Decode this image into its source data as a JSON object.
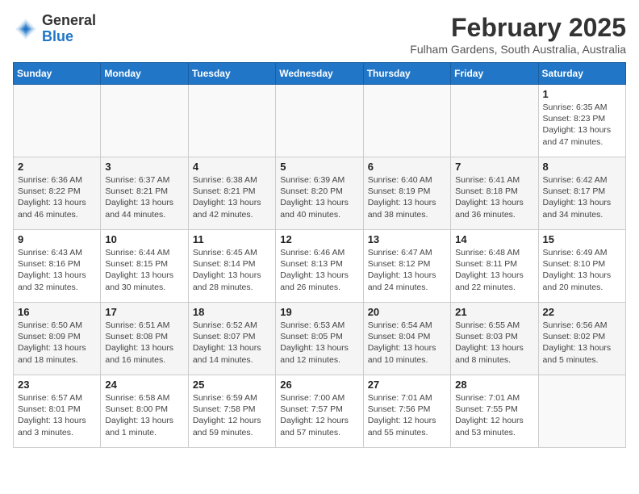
{
  "header": {
    "logo_general": "General",
    "logo_blue": "Blue",
    "month": "February 2025",
    "location": "Fulham Gardens, South Australia, Australia"
  },
  "weekdays": [
    "Sunday",
    "Monday",
    "Tuesday",
    "Wednesday",
    "Thursday",
    "Friday",
    "Saturday"
  ],
  "weeks": [
    [
      {
        "day": "",
        "info": ""
      },
      {
        "day": "",
        "info": ""
      },
      {
        "day": "",
        "info": ""
      },
      {
        "day": "",
        "info": ""
      },
      {
        "day": "",
        "info": ""
      },
      {
        "day": "",
        "info": ""
      },
      {
        "day": "1",
        "info": "Sunrise: 6:35 AM\nSunset: 8:23 PM\nDaylight: 13 hours and 47 minutes."
      }
    ],
    [
      {
        "day": "2",
        "info": "Sunrise: 6:36 AM\nSunset: 8:22 PM\nDaylight: 13 hours and 46 minutes."
      },
      {
        "day": "3",
        "info": "Sunrise: 6:37 AM\nSunset: 8:21 PM\nDaylight: 13 hours and 44 minutes."
      },
      {
        "day": "4",
        "info": "Sunrise: 6:38 AM\nSunset: 8:21 PM\nDaylight: 13 hours and 42 minutes."
      },
      {
        "day": "5",
        "info": "Sunrise: 6:39 AM\nSunset: 8:20 PM\nDaylight: 13 hours and 40 minutes."
      },
      {
        "day": "6",
        "info": "Sunrise: 6:40 AM\nSunset: 8:19 PM\nDaylight: 13 hours and 38 minutes."
      },
      {
        "day": "7",
        "info": "Sunrise: 6:41 AM\nSunset: 8:18 PM\nDaylight: 13 hours and 36 minutes."
      },
      {
        "day": "8",
        "info": "Sunrise: 6:42 AM\nSunset: 8:17 PM\nDaylight: 13 hours and 34 minutes."
      }
    ],
    [
      {
        "day": "9",
        "info": "Sunrise: 6:43 AM\nSunset: 8:16 PM\nDaylight: 13 hours and 32 minutes."
      },
      {
        "day": "10",
        "info": "Sunrise: 6:44 AM\nSunset: 8:15 PM\nDaylight: 13 hours and 30 minutes."
      },
      {
        "day": "11",
        "info": "Sunrise: 6:45 AM\nSunset: 8:14 PM\nDaylight: 13 hours and 28 minutes."
      },
      {
        "day": "12",
        "info": "Sunrise: 6:46 AM\nSunset: 8:13 PM\nDaylight: 13 hours and 26 minutes."
      },
      {
        "day": "13",
        "info": "Sunrise: 6:47 AM\nSunset: 8:12 PM\nDaylight: 13 hours and 24 minutes."
      },
      {
        "day": "14",
        "info": "Sunrise: 6:48 AM\nSunset: 8:11 PM\nDaylight: 13 hours and 22 minutes."
      },
      {
        "day": "15",
        "info": "Sunrise: 6:49 AM\nSunset: 8:10 PM\nDaylight: 13 hours and 20 minutes."
      }
    ],
    [
      {
        "day": "16",
        "info": "Sunrise: 6:50 AM\nSunset: 8:09 PM\nDaylight: 13 hours and 18 minutes."
      },
      {
        "day": "17",
        "info": "Sunrise: 6:51 AM\nSunset: 8:08 PM\nDaylight: 13 hours and 16 minutes."
      },
      {
        "day": "18",
        "info": "Sunrise: 6:52 AM\nSunset: 8:07 PM\nDaylight: 13 hours and 14 minutes."
      },
      {
        "day": "19",
        "info": "Sunrise: 6:53 AM\nSunset: 8:05 PM\nDaylight: 13 hours and 12 minutes."
      },
      {
        "day": "20",
        "info": "Sunrise: 6:54 AM\nSunset: 8:04 PM\nDaylight: 13 hours and 10 minutes."
      },
      {
        "day": "21",
        "info": "Sunrise: 6:55 AM\nSunset: 8:03 PM\nDaylight: 13 hours and 8 minutes."
      },
      {
        "day": "22",
        "info": "Sunrise: 6:56 AM\nSunset: 8:02 PM\nDaylight: 13 hours and 5 minutes."
      }
    ],
    [
      {
        "day": "23",
        "info": "Sunrise: 6:57 AM\nSunset: 8:01 PM\nDaylight: 13 hours and 3 minutes."
      },
      {
        "day": "24",
        "info": "Sunrise: 6:58 AM\nSunset: 8:00 PM\nDaylight: 13 hours and 1 minute."
      },
      {
        "day": "25",
        "info": "Sunrise: 6:59 AM\nSunset: 7:58 PM\nDaylight: 12 hours and 59 minutes."
      },
      {
        "day": "26",
        "info": "Sunrise: 7:00 AM\nSunset: 7:57 PM\nDaylight: 12 hours and 57 minutes."
      },
      {
        "day": "27",
        "info": "Sunrise: 7:01 AM\nSunset: 7:56 PM\nDaylight: 12 hours and 55 minutes."
      },
      {
        "day": "28",
        "info": "Sunrise: 7:01 AM\nSunset: 7:55 PM\nDaylight: 12 hours and 53 minutes."
      },
      {
        "day": "",
        "info": ""
      }
    ]
  ]
}
